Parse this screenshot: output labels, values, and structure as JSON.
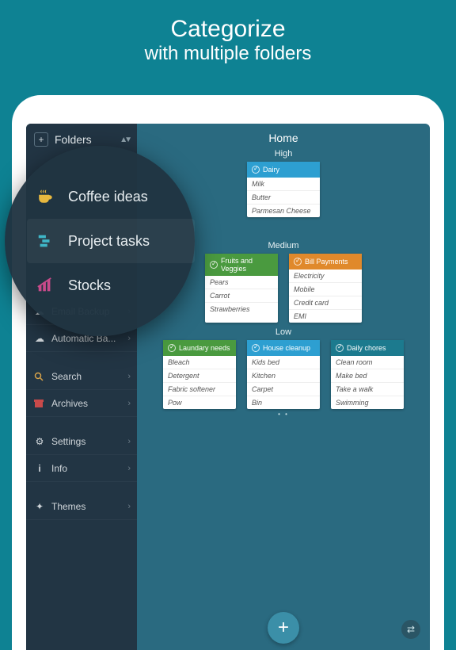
{
  "promo": {
    "line1": "Categorize",
    "line2": "with multiple folders"
  },
  "sidebar": {
    "folders_label": "Folders",
    "items": [
      {
        "icon": "☁",
        "label": "Email Backup"
      },
      {
        "icon": "☁",
        "label": "Automatic Ba..."
      }
    ],
    "items2": [
      {
        "icon": "search",
        "label": "Search"
      },
      {
        "icon": "archive",
        "label": "Archives"
      }
    ],
    "items3": [
      {
        "icon": "gear",
        "label": "Settings"
      },
      {
        "icon": "info",
        "label": "Info"
      }
    ],
    "items4": [
      {
        "icon": "themes",
        "label": "Themes"
      }
    ]
  },
  "bubble": {
    "rows": [
      {
        "label": "Coffee ideas",
        "color": "#e8b93f"
      },
      {
        "label": "Project tasks",
        "color": "#3fb7c8"
      },
      {
        "label": "Stocks",
        "color": "#c84a8a"
      }
    ]
  },
  "main": {
    "title": "Home",
    "sections": {
      "high": {
        "label": "High",
        "cards": [
          {
            "color": "c-blue",
            "title": "Dairy",
            "items": [
              "Milk",
              "Butter",
              "Parmesan Cheese"
            ]
          }
        ]
      },
      "medium": {
        "label": "Medium",
        "cards": [
          {
            "color": "c-green",
            "title": "Fruits and Veggies",
            "items": [
              "Pears",
              "Carrot",
              "Strawberries"
            ]
          },
          {
            "color": "c-orange",
            "title": "Bill Payments",
            "items": [
              "Electricity",
              "Mobile",
              "Credit card",
              "EMI"
            ]
          }
        ]
      },
      "low": {
        "label": "Low",
        "cards": [
          {
            "color": "c-green2",
            "title": "Laundary needs",
            "items": [
              "Bleach",
              "Detergent",
              "Fabric softener",
              "Pow"
            ]
          },
          {
            "color": "c-teal",
            "title": "House cleanup",
            "items": [
              "Kids bed",
              "Kitchen",
              "Carpet",
              "Bin"
            ]
          },
          {
            "color": "c-deep",
            "title": "Daily chores",
            "items": [
              "Clean room",
              "Make bed",
              "Take a walk",
              "Swimming"
            ]
          }
        ]
      }
    }
  }
}
